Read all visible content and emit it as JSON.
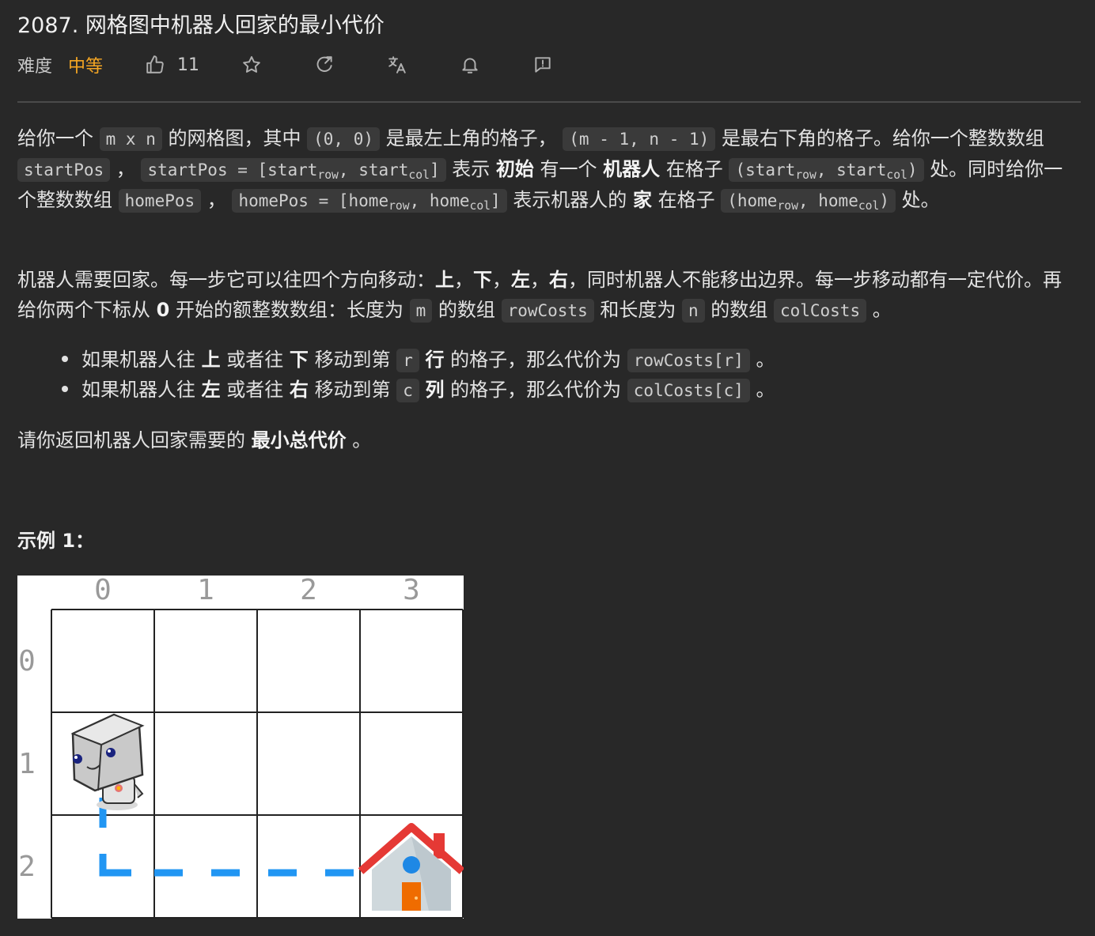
{
  "title": "2087. 网格图中机器人回家的最小代价",
  "meta": {
    "difficulty_label": "难度",
    "difficulty_value": "中等",
    "likes": "11",
    "icons": [
      "thumbs-up-icon",
      "star-icon",
      "share-icon",
      "translate-icon",
      "bell-icon",
      "feedback-icon"
    ]
  },
  "desc": {
    "p1": {
      "t1": "给你一个",
      "c1": "m x n",
      "t2": "的网格图，其中",
      "c2": "(0, 0)",
      "t3": "是最左上角的格子，",
      "c3": "(m - 1, n - 1)",
      "t4": "是最右下角的格子。给你一个整数数组",
      "c4": "startPos",
      "t5": "，",
      "c5a": "startPos = [start",
      "c5s1": "row",
      "c5b": ", start",
      "c5s2": "col",
      "c5c": "]",
      "t6": "表示",
      "b1": "初始",
      "t7": "有一个",
      "b2": "机器人",
      "t8": "在格子",
      "c6a": "(start",
      "c6s1": "row",
      "c6b": ", start",
      "c6s2": "col",
      "c6c": ")",
      "t9": "处。同时给你一个整数数组",
      "c7": "homePos",
      "t10": "，",
      "c8a": "homePos = [home",
      "c8s1": "row",
      "c8b": ", home",
      "c8s2": "col",
      "c8c": "]",
      "t11": "表示机器人的",
      "b3": "家",
      "t12": "在格子",
      "c9a": "(home",
      "c9s1": "row",
      "c9b": ", home",
      "c9s2": "col",
      "c9c": ")",
      "t13": "处。"
    },
    "p2": {
      "t1": "机器人需要回家。每一步它可以往四个方向移动：",
      "b1": "上",
      "s1": "，",
      "b2": "下",
      "s2": "，",
      "b3": "左",
      "s3": "，",
      "b4": "右",
      "t2": "，同时机器人不能移出边界。每一步移动都有一定代价。再给你两个下标从",
      "b5": "0",
      "t3": "开始的额整数数组：长度为",
      "c1": "m",
      "t4": "的数组",
      "c2": "rowCosts",
      "t5": "和长度为",
      "c3": "n",
      "t6": "的数组",
      "c4": "colCosts",
      "t7": "。"
    },
    "bullets": [
      {
        "t1": "如果机器人往",
        "b1": "上",
        "t2": "或者往",
        "b2": "下",
        "t3": "移动到第",
        "c1": "r",
        "b3": "行",
        "t4": "的格子，那么代价为",
        "c2": "rowCosts[r]",
        "t5": "。"
      },
      {
        "t1": "如果机器人往",
        "b1": "左",
        "t2": "或者往",
        "b2": "右",
        "t3": "移动到第",
        "c1": "c",
        "b3": "列",
        "t4": "的格子，那么代价为",
        "c2": "colCosts[c]",
        "t5": "。"
      }
    ],
    "p3": {
      "t1": "请你返回机器人回家需要的",
      "b1": "最小总代价",
      "t2": "。"
    }
  },
  "example": {
    "label": "示例 1："
  },
  "figure": {
    "col_labels": [
      "0",
      "1",
      "2",
      "3"
    ],
    "row_labels": [
      "0",
      "1",
      "2"
    ],
    "robot_cell": [
      1,
      0
    ],
    "home_cell": [
      2,
      3
    ],
    "path_color": "#2196f3",
    "roof_color": "#e53935"
  }
}
